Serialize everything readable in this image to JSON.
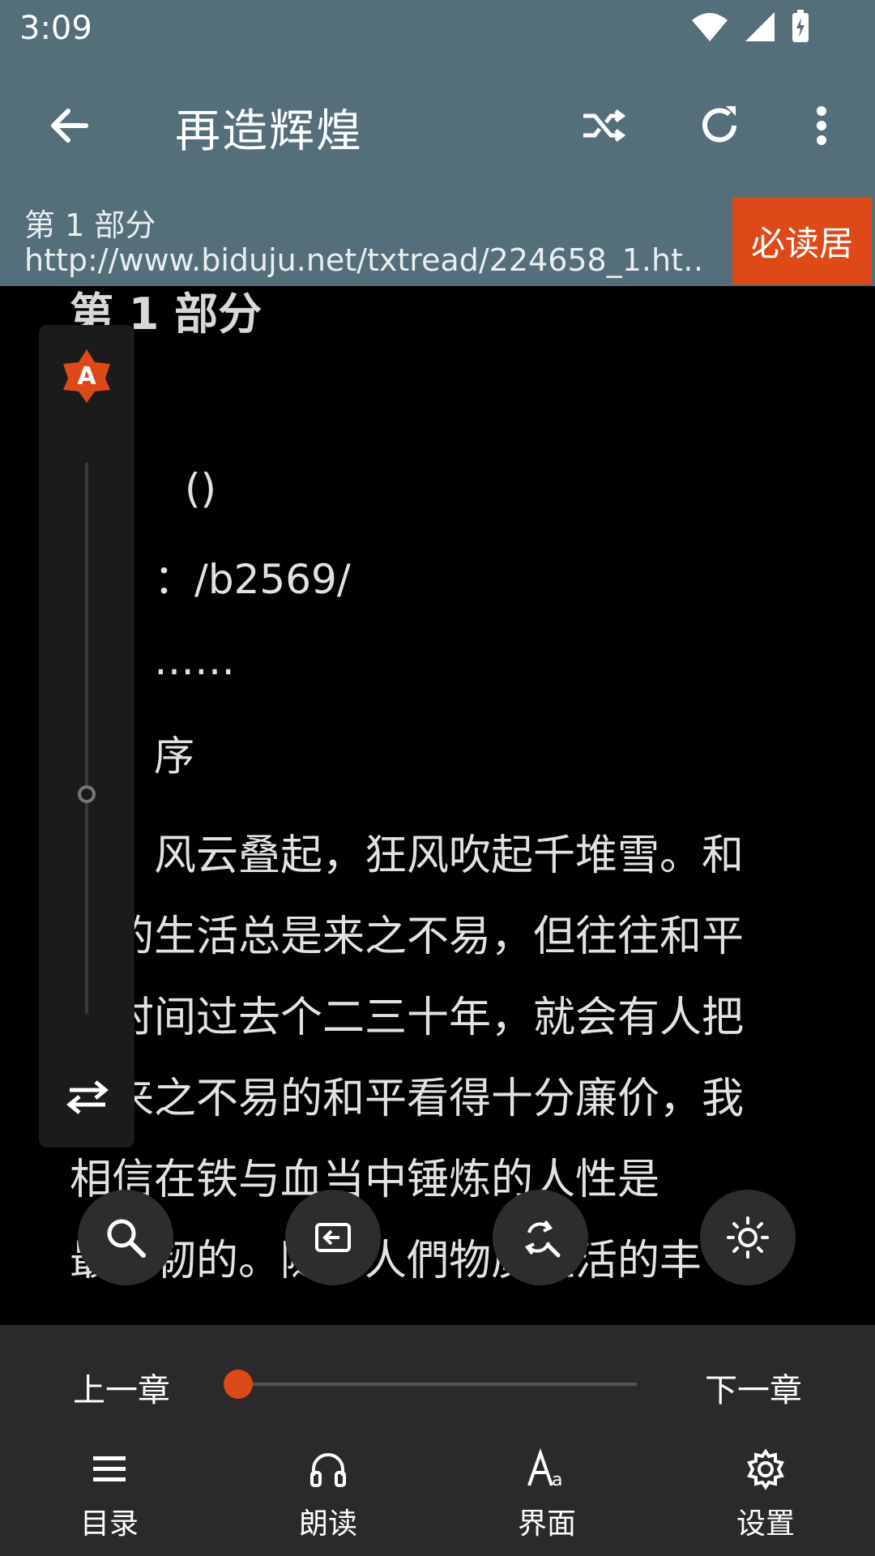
{
  "status": {
    "time": "3:09"
  },
  "appbar": {
    "title": "再造辉煌"
  },
  "source": {
    "chapter": "第 1 部分",
    "url": "http://www.biduju.net/txtread/224658_1.ht…",
    "badge": "必读居"
  },
  "content": {
    "heading": "第 1 部分",
    "line_paren": "()",
    "line_path": "：/b2569/",
    "line_dots": "……",
    "line_xu": "序",
    "para": [
      "　　风云叠起，狂风吹起千堆雪。和",
      "平的生活总是来之不易，但往往和平",
      "的时间过去个二三十年，就会有人把",
      "这来之不易的和平看得十分廉价，我",
      "相信在铁与血当中锤炼的人性是",
      "最坚韧的。随着人們物质生活的丰"
    ]
  },
  "side": {
    "auto_label": "A"
  },
  "bottom": {
    "prev": "上一章",
    "next": "下一章",
    "progress": 0.0,
    "tabs": [
      {
        "label": "目录",
        "icon": "list-icon"
      },
      {
        "label": "朗读",
        "icon": "headphones-icon"
      },
      {
        "label": "界面",
        "icon": "font-icon"
      },
      {
        "label": "设置",
        "icon": "gear-icon"
      }
    ]
  },
  "colors": {
    "appbar": "#546e7a",
    "accent": "#dd4a18"
  }
}
